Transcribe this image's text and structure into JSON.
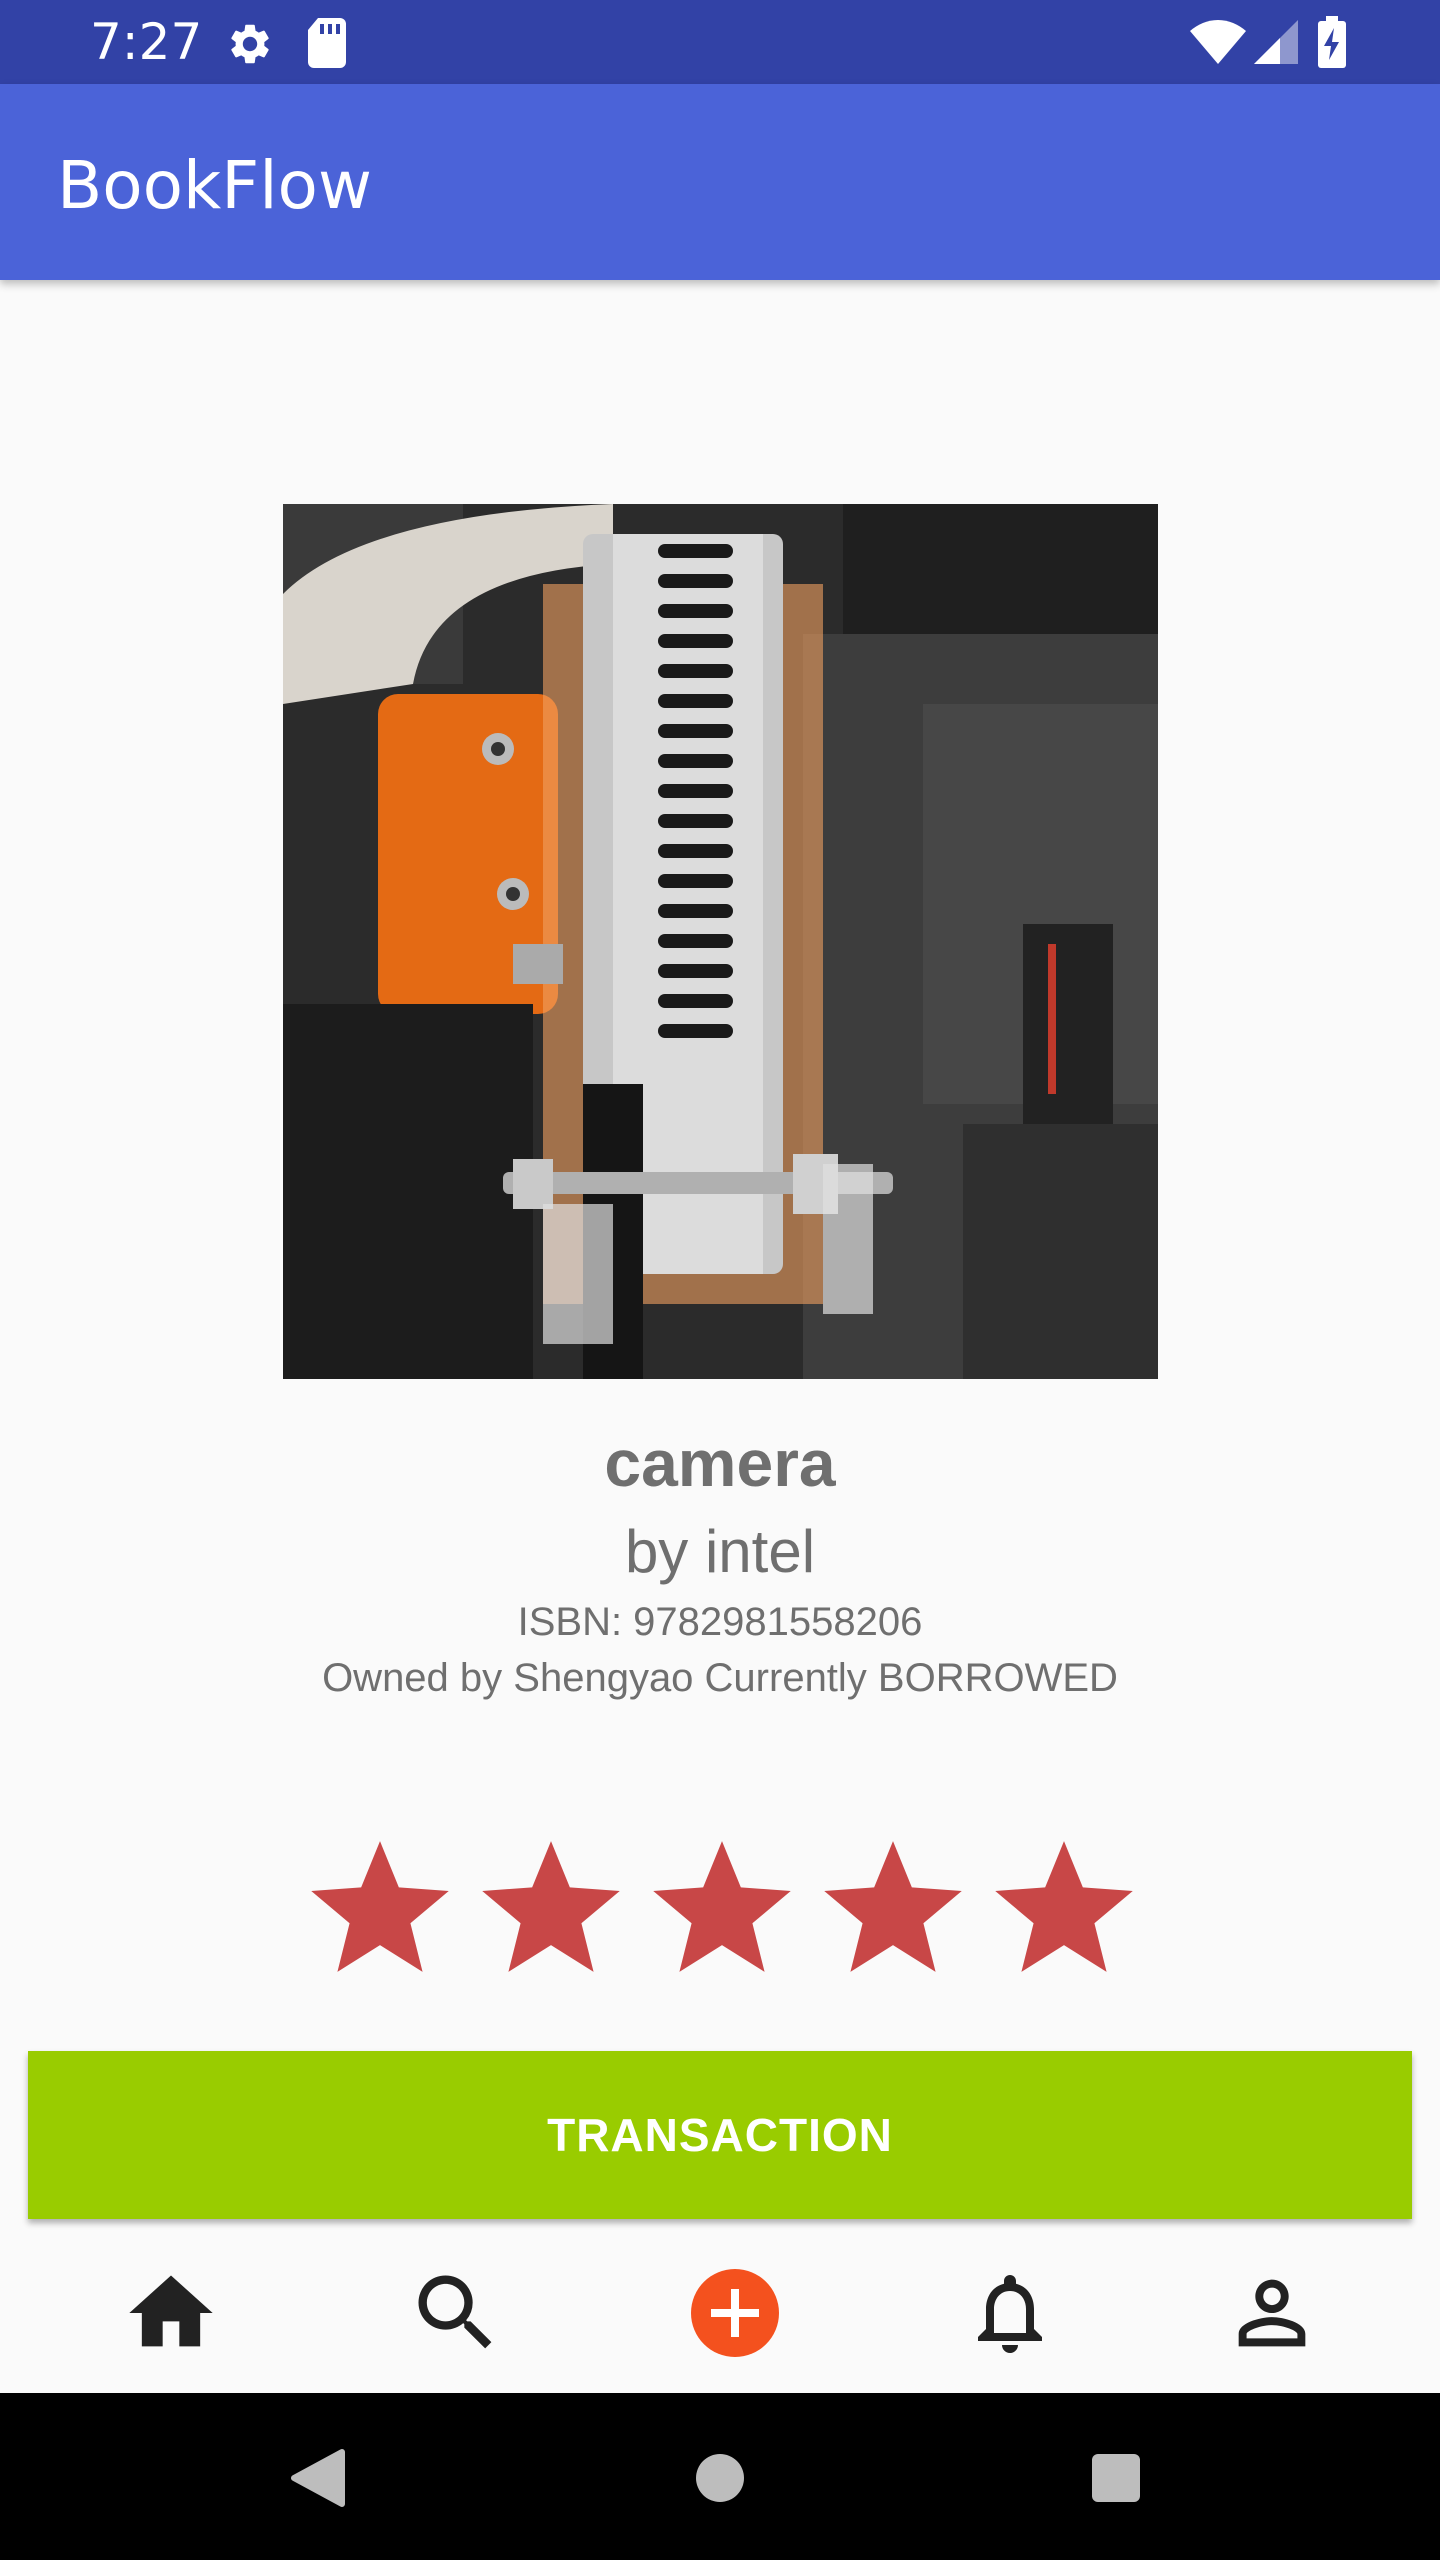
{
  "status_bar": {
    "time": "7:27",
    "icons": [
      "gear-icon",
      "sd-card-icon",
      "wifi-icon",
      "cell-signal-icon",
      "battery-charging-icon"
    ]
  },
  "app_bar": {
    "title": "BookFlow"
  },
  "book": {
    "cover_image": "photo of camera hardware mounted with screws",
    "title": "camera",
    "author": "by intel",
    "isbn": "ISBN: 9782981558206",
    "owner_status": "Owned by Shengyao Currently BORROWED"
  },
  "rating": {
    "value": 5,
    "max": 5,
    "star_color": "#c84747"
  },
  "actions": {
    "transaction_label": "TRANSACTION",
    "button_color": "#99cc00"
  },
  "bottom_nav": {
    "items": [
      "home-icon",
      "search-icon",
      "add-icon",
      "notifications-icon",
      "profile-icon"
    ],
    "accent_color": "#f4511e"
  },
  "system_nav": {
    "buttons": [
      "back",
      "home",
      "recents"
    ]
  }
}
